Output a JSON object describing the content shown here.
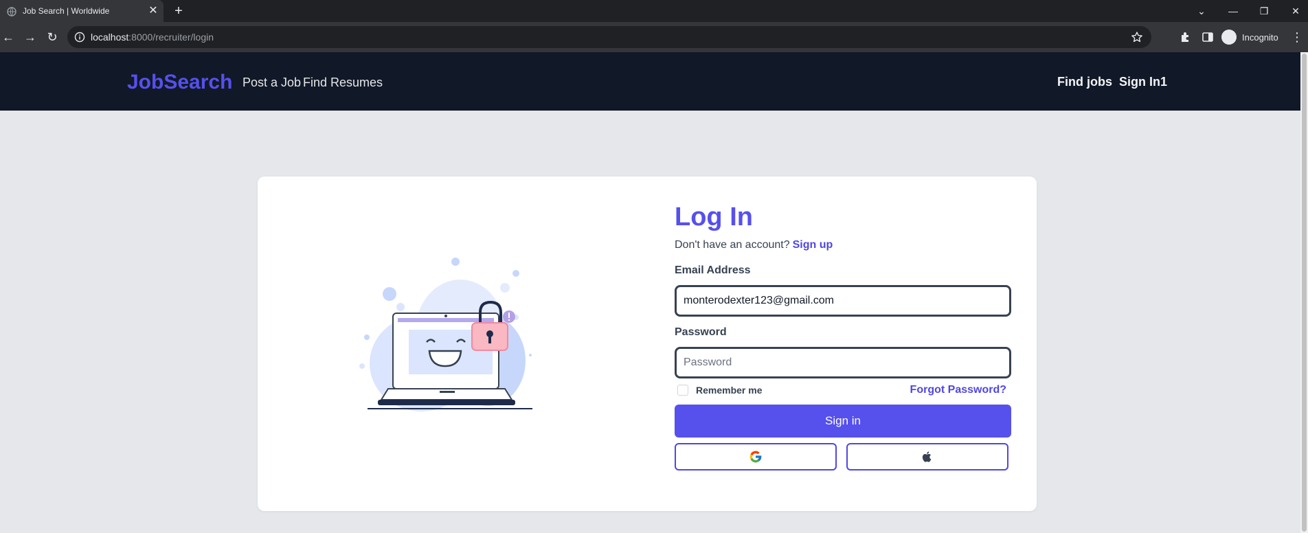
{
  "browser": {
    "tab_title": "Job Search | Worldwide",
    "url_host": "localhost",
    "url_path": ":8000/recruiter/login",
    "profile_label": "Incognito"
  },
  "header": {
    "logo": "JobSearch",
    "nav_left": [
      "Post a Job",
      "Find Resumes"
    ],
    "nav_right": [
      "Find jobs",
      "Sign In1"
    ]
  },
  "login": {
    "title": "Log In",
    "signup_prompt": "Don't have an account?",
    "signup_link": "Sign up",
    "email_label": "Email Address",
    "email_value": "monterodexter123@gmail.com",
    "password_label": "Password",
    "password_placeholder": "Password",
    "remember_label": "Remember me",
    "remember_checked": false,
    "forgot_label": "Forgot Password?",
    "signin_label": "Sign in",
    "social_buttons": [
      "google-icon",
      "apple-icon"
    ]
  },
  "colors": {
    "brand": "#5650ed",
    "header_bg": "#111827",
    "page_bg": "#e5e7eb"
  }
}
